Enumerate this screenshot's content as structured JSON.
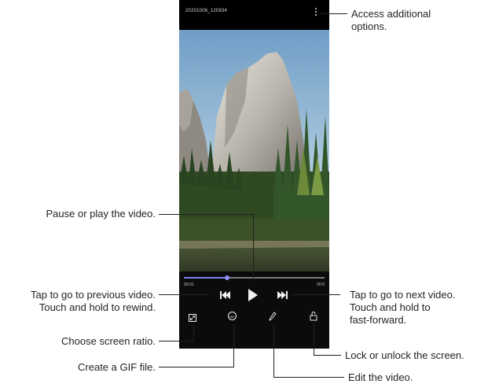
{
  "player": {
    "title": "20201006_120834",
    "time_current": "00:01",
    "time_total": "00:0",
    "progress": 0.31,
    "icons": {
      "more": "more-options-icon",
      "previous": "previous-video-icon",
      "play": "play-icon",
      "next": "next-video-icon",
      "ratio": "screen-ratio-icon",
      "gif": "gif-icon",
      "edit": "edit-pencil-icon",
      "lock": "lock-icon"
    },
    "gif_label": "GIF"
  },
  "callouts": {
    "more_options": [
      "Access additional",
      "options."
    ],
    "play_pause": [
      "Pause or play the video."
    ],
    "previous": [
      "Tap to go to previous video.",
      "Touch and hold to rewind."
    ],
    "next": [
      "Tap to go to next video.",
      "Touch and hold to",
      "fast-forward."
    ],
    "screen_ratio": [
      "Choose screen ratio."
    ],
    "gif": [
      "Create a GIF file."
    ],
    "lock": [
      "Lock or unlock the screen."
    ],
    "edit": [
      "Edit the video."
    ]
  },
  "colors": {
    "accent": "#7c7cf0",
    "background": "#000000",
    "callout_text": "#231f20"
  }
}
